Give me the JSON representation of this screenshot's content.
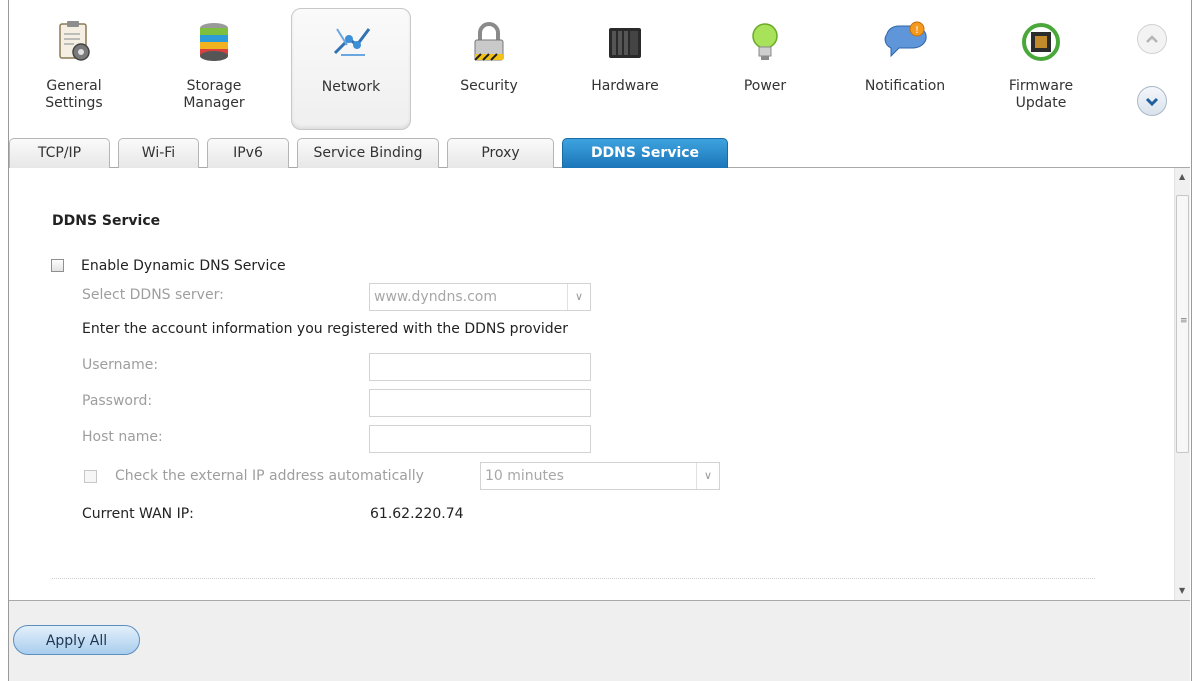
{
  "topbar": {
    "items": [
      {
        "label": "General\nSettings",
        "icon": "general-settings-icon"
      },
      {
        "label": "Storage\nManager",
        "icon": "storage-manager-icon"
      },
      {
        "label": "Network",
        "icon": "network-icon"
      },
      {
        "label": "Security",
        "icon": "lock-icon"
      },
      {
        "label": "Hardware",
        "icon": "hardware-icon"
      },
      {
        "label": "Power",
        "icon": "lightbulb-icon"
      },
      {
        "label": "Notification",
        "icon": "notification-icon"
      },
      {
        "label": "Firmware\nUpdate",
        "icon": "firmware-update-icon"
      }
    ],
    "active": "Network"
  },
  "tabs": [
    "TCP/IP",
    "Wi-Fi",
    "IPv6",
    "Service Binding",
    "Proxy",
    "DDNS Service"
  ],
  "active_tab": "DDNS Service",
  "ddns": {
    "section_title": "DDNS Service",
    "enable_label": "Enable Dynamic DNS Service",
    "enable_checked": false,
    "server_label": "Select DDNS server:",
    "server_value": "www.dyndns.com",
    "account_info": "Enter the account information you registered with the DDNS provider",
    "username_label": "Username:",
    "username_value": "",
    "password_label": "Password:",
    "password_value": "",
    "hostname_label": "Host name:",
    "hostname_value": "",
    "check_ip_label": "Check the external IP address automatically",
    "check_ip_checked": false,
    "check_interval": "10 minutes",
    "wan_ip_label": "Current WAN IP:",
    "wan_ip_value": "61.62.220.74"
  },
  "footer": {
    "apply_label": "Apply All"
  },
  "colors": {
    "active_tab": "#1a74b8",
    "muted_text": "#9e9e9e",
    "footer_bg": "#efefef"
  }
}
